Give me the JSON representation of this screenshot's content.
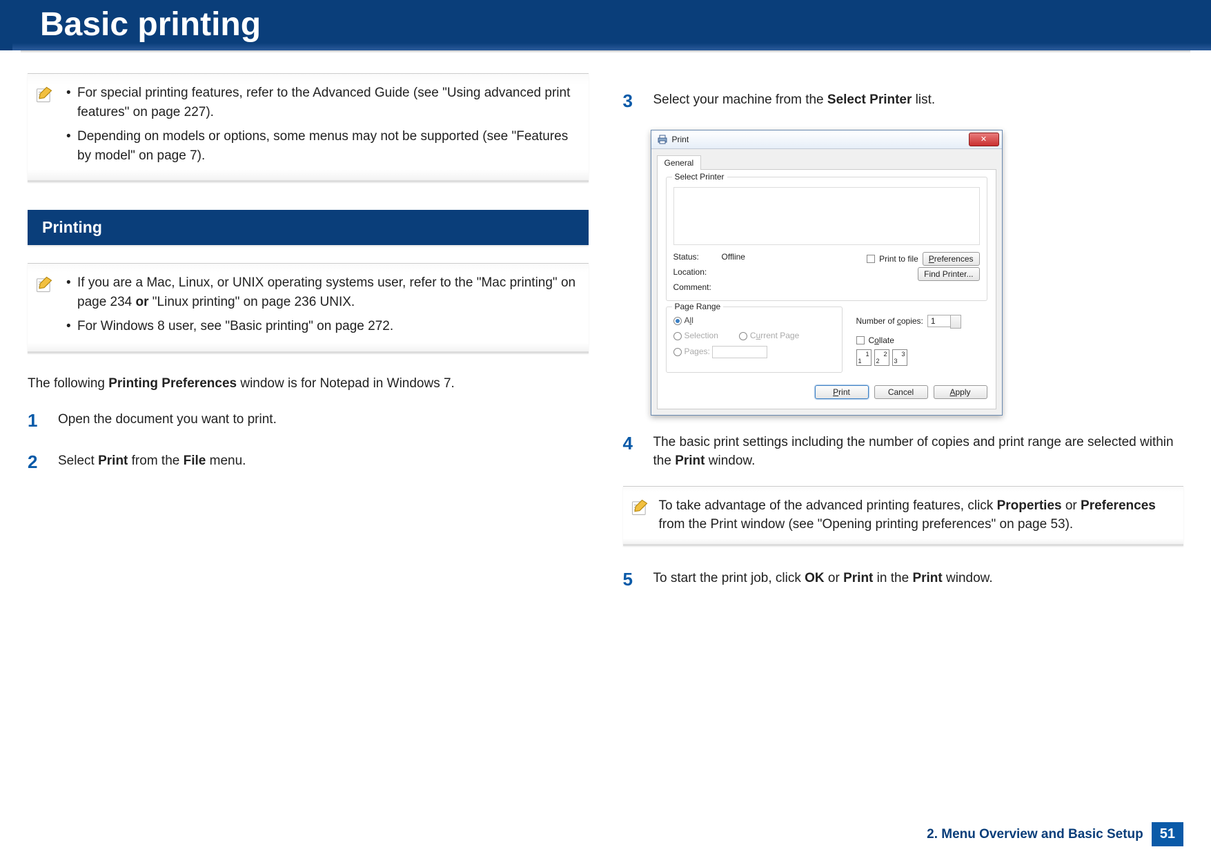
{
  "title": "Basic printing",
  "left": {
    "note1": {
      "items": [
        "For special printing features, refer to the Advanced Guide (see \"Using advanced print features\" on page 227).",
        "Depending on models or options, some menus may not be supported (see \"Features by model\" on page 7)."
      ]
    },
    "section_heading": "Printing",
    "note2": {
      "items_html": [
        "If you are a Mac, Linux, or UNIX operating systems user, refer to the \"Mac printing\" on page 234 <b>or</b> \"Linux printing\" on page 236 UNIX.",
        "For Windows 8 user, see \"Basic printing\" on page 272."
      ]
    },
    "intro_html": "The following <b>Printing Preferences</b> window is for Notepad in Windows 7.",
    "step1": {
      "num": "1",
      "text": "Open the document you want to print."
    },
    "step2": {
      "num": "2",
      "html": "Select <b>Print</b> from the <b>File</b> menu."
    }
  },
  "right": {
    "step3": {
      "num": "3",
      "html": "Select your machine from the <b>Select Printer</b> list."
    },
    "dialog": {
      "title": "Print",
      "close_label": "✕",
      "tab_general": "General",
      "select_printer_legend": "Select Printer",
      "status_label": "Status:",
      "status_value": "Offline",
      "location_label": "Location:",
      "comment_label": "Comment:",
      "print_to_file": "Print to file",
      "preferences_btn": "Preferences",
      "find_printer_btn": "Find Printer...",
      "page_range_legend": "Page Range",
      "opt_all": "All",
      "opt_selection": "Selection",
      "opt_current": "Current Page",
      "opt_pages": "Pages:",
      "copies_label": "Number of copies:",
      "copies_value": "1",
      "collate_label": "Collate",
      "btn_print": "Print",
      "btn_cancel": "Cancel",
      "btn_apply": "Apply"
    },
    "step4": {
      "num": "4",
      "html": "The basic print settings including the number of copies and print range are selected within the <b>Print</b> window."
    },
    "note3_html": "To take advantage of the advanced printing features, click <b>Properties</b> or <b>Preferences</b> from the Print window (see \"Opening printing preferences\" on page 53).",
    "step5": {
      "num": "5",
      "html": "To start the print job, click <b>OK</b> or <b>Print</b> in the <b>Print</b> window."
    }
  },
  "footer": {
    "chapter": "2. Menu Overview and Basic Setup",
    "page": "51"
  }
}
